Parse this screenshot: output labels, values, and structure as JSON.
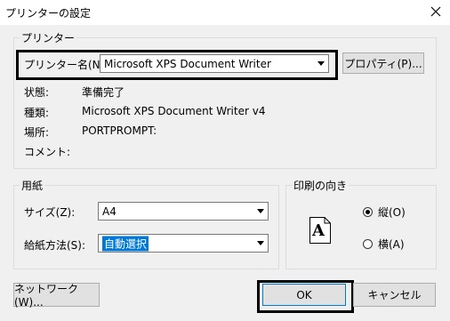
{
  "window": {
    "title": "プリンターの設定"
  },
  "printer_group": {
    "legend": "プリンター",
    "name_label": "プリンター名(N):",
    "name_value": "Microsoft XPS Document Writer",
    "properties_button": "プロパティ(P)...",
    "status_label": "状態:",
    "status_value": "準備完了",
    "type_label": "種類:",
    "type_value": "Microsoft XPS Document Writer v4",
    "where_label": "場所:",
    "where_value": "PORTPROMPT:",
    "comment_label": "コメント:",
    "comment_value": ""
  },
  "paper_group": {
    "legend": "用紙",
    "size_label": "サイズ(Z):",
    "size_value": "A4",
    "source_label": "給紙方法(S):",
    "source_value": "自動選択"
  },
  "orientation_group": {
    "legend": "印刷の向き",
    "page_icon_letter": "A",
    "portrait_label": "縦(O)",
    "landscape_label": "横(A)",
    "selected": "portrait"
  },
  "buttons": {
    "network": "ネットワーク(W)...",
    "ok": "OK",
    "cancel": "キャンセル"
  }
}
